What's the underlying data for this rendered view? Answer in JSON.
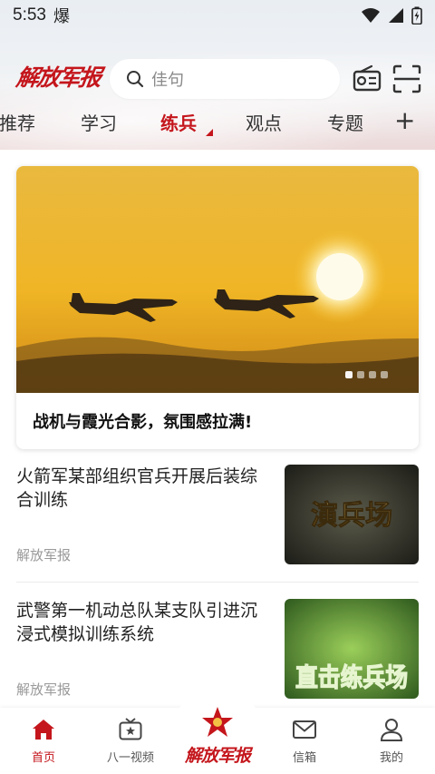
{
  "status_bar": {
    "time": "5:53",
    "extra": "爆",
    "icons": [
      "wifi-icon",
      "signal-icon",
      "battery-icon"
    ]
  },
  "header": {
    "logo_text": "解放军报",
    "search_placeholder": "佳句",
    "icons": [
      "radio-icon",
      "scan-icon"
    ]
  },
  "tabs": [
    {
      "label": "推荐",
      "active": false
    },
    {
      "label": "学习",
      "active": false
    },
    {
      "label": "练兵",
      "active": true
    },
    {
      "label": "观点",
      "active": false
    },
    {
      "label": "专题",
      "active": false
    }
  ],
  "tabs_more": "+",
  "featured": {
    "title": "战机与霞光合影，氛围感拉满!",
    "carousel_count": 4,
    "carousel_active": 1
  },
  "news": [
    {
      "title": "火箭军某部组织官兵开展后装综合训练",
      "source": "解放军报",
      "thumb_text": "演兵场"
    },
    {
      "title": "武警第一机动总队某支队引进沉浸式模拟训练系统",
      "source": "解放军报",
      "thumb_text": "直击练兵场"
    }
  ],
  "bottom_nav": [
    {
      "label": "首页",
      "icon": "home-icon",
      "active": true
    },
    {
      "label": "八一视频",
      "icon": "tv-icon",
      "active": false
    },
    {
      "label": "解放军报",
      "icon": "star-emblem-icon",
      "active": false
    },
    {
      "label": "信箱",
      "icon": "mail-icon",
      "active": false
    },
    {
      "label": "我的",
      "icon": "user-icon",
      "active": false
    }
  ],
  "colors": {
    "brand": "#c4161c",
    "text": "#222222",
    "muted": "#999999"
  }
}
